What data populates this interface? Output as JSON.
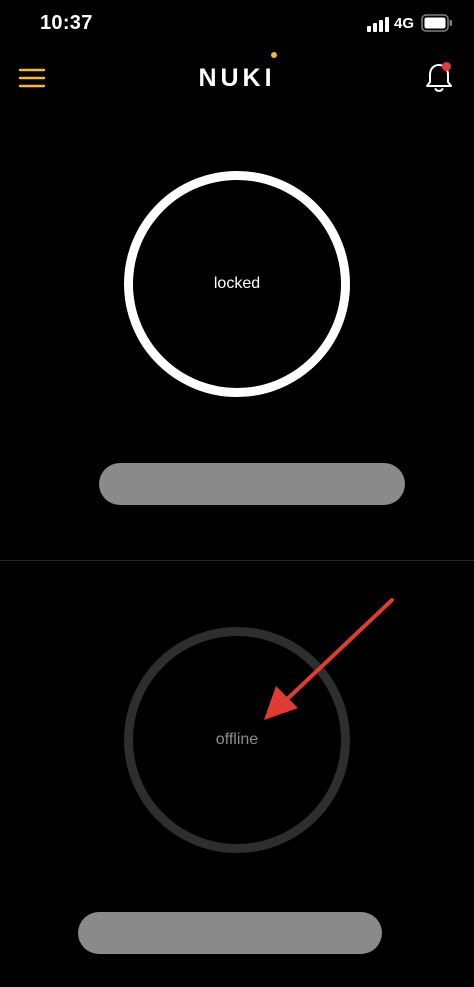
{
  "status_bar": {
    "time": "10:37",
    "network": "4G",
    "signal_icon": "cellular-signal-icon",
    "battery_icon": "battery-icon"
  },
  "header": {
    "menu_icon": "hamburger-menu-icon",
    "brand": "NUKI",
    "notification_icon": "bell-icon"
  },
  "locks": [
    {
      "state": "locked"
    },
    {
      "state": "offline"
    }
  ],
  "colors": {
    "background": "#000000",
    "accent": "#f5b931",
    "badge": "#e53935",
    "ring_active": "#ffffff",
    "ring_offline": "#2e2e2e",
    "redacted_bar": "#8a8a8a",
    "annotation_arrow": "#e03c31"
  }
}
